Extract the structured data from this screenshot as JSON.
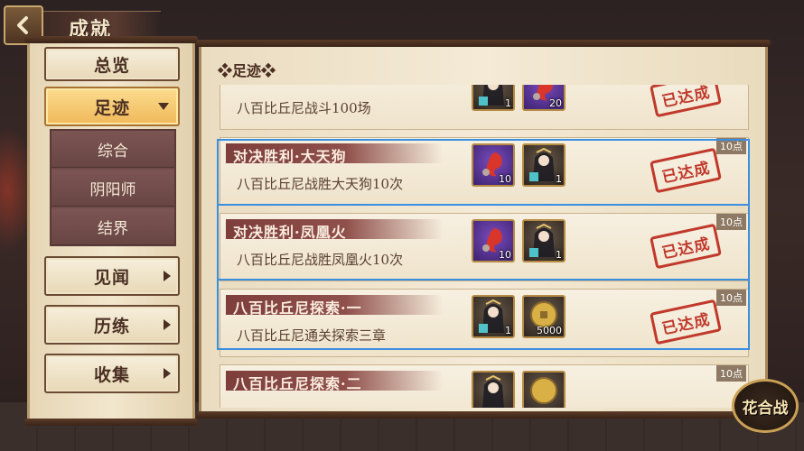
{
  "header": {
    "title": "成就",
    "back_icon": "back-arrow-icon"
  },
  "sidebar": {
    "overview": "总览",
    "footprints": "足迹",
    "sub_items": [
      "综合",
      "阴阳师",
      "结界"
    ],
    "jianwen": "见闻",
    "lilian": "历练",
    "shouji": "收集"
  },
  "main": {
    "section_title": "❖足迹❖",
    "achievements": [
      {
        "title": "",
        "desc": "八百比丘尼战斗100场",
        "status": "已达成",
        "points": "",
        "rewards": [
          {
            "icon": "bikuni-shikigami-card-icon",
            "qty": "1"
          },
          {
            "icon": "red-daruma-icon",
            "qty": "20"
          }
        ]
      },
      {
        "title": "对决胜利·大天狗",
        "desc": "八百比丘尼战胜大天狗10次",
        "status": "已达成",
        "points": "10点",
        "rewards": [
          {
            "icon": "red-daruma-icon",
            "qty": "10"
          },
          {
            "icon": "bikuni-shikigami-card-icon",
            "qty": "1"
          }
        ]
      },
      {
        "title": "对决胜利·凤凰火",
        "desc": "八百比丘尼战胜凤凰火10次",
        "status": "已达成",
        "points": "10点",
        "rewards": [
          {
            "icon": "red-daruma-icon",
            "qty": "10"
          },
          {
            "icon": "bikuni-shikigami-card-icon",
            "qty": "1"
          }
        ]
      },
      {
        "title": "八百比丘尼探索·一",
        "desc": "八百比丘尼通关探索三章",
        "status": "已达成",
        "points": "10点",
        "rewards": [
          {
            "icon": "bikuni-shikigami-card-icon",
            "qty": "1"
          },
          {
            "icon": "gold-coin-icon",
            "qty": "5000"
          }
        ]
      },
      {
        "title": "八百比丘尼探索·二",
        "desc": "",
        "status": "",
        "points": "10点",
        "rewards": [
          {
            "icon": "bikuni-shikigami-card-icon",
            "qty": ""
          },
          {
            "icon": "gold-coin-icon",
            "qty": ""
          }
        ]
      }
    ]
  },
  "badge": {
    "label": "花合战"
  },
  "colors": {
    "highlight": "#3a8fe0",
    "stamp_red": "#c0392b",
    "active_tab": "#f0b85a",
    "title_bar": "#7e3f3c"
  }
}
